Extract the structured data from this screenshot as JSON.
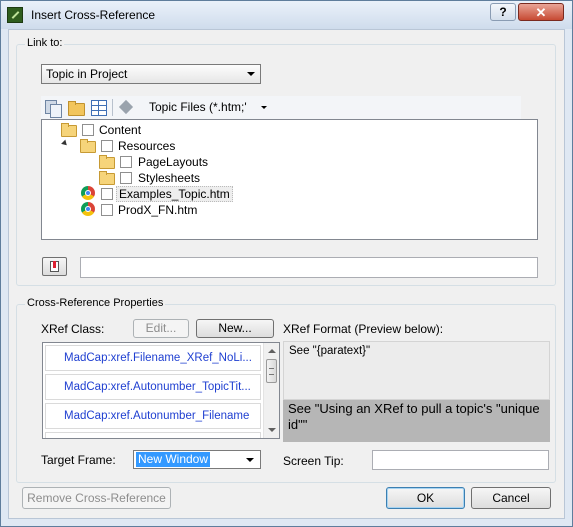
{
  "window": {
    "title": "Insert Cross-Reference",
    "help_label": "?",
    "close_label": "✕"
  },
  "link_to": {
    "group_label": "Link to:",
    "selected": "Topic in Project",
    "filter_label": "Topic Files (*.htm;'",
    "tree": [
      {
        "label": "Content",
        "icon": "folder-icon"
      },
      {
        "label": "Resources",
        "icon": "folder-icon"
      },
      {
        "label": "PageLayouts",
        "icon": "folder-icon"
      },
      {
        "label": "Stylesheets",
        "icon": "folder-icon"
      },
      {
        "label": "Examples_Topic.htm",
        "icon": "chrome-icon"
      },
      {
        "label": "ProdX_FN.htm",
        "icon": "chrome-icon"
      }
    ],
    "bookmark_value": ""
  },
  "xref": {
    "group_label": "Cross-Reference Properties",
    "class_label": "XRef Class:",
    "edit_label": "Edit...",
    "new_label": "New...",
    "format_label": "XRef Format (Preview below):",
    "items": [
      "MadCap:xref.Filename_XRef_NoLi...",
      "MadCap:xref.Autonumber_TopicTit...",
      "MadCap:xref.Autonumber_Filename"
    ],
    "format_value": "See \"{paratext}\"",
    "preview_value": "See \"Using an XRef to pull a topic's \"unique id\"\"",
    "target_frame_label": "Target Frame:",
    "target_frame_value": "New Window",
    "screen_tip_label": "Screen Tip:",
    "screen_tip_value": ""
  },
  "footer": {
    "remove_label": "Remove Cross-Reference",
    "ok_label": "OK",
    "cancel_label": "Cancel"
  }
}
